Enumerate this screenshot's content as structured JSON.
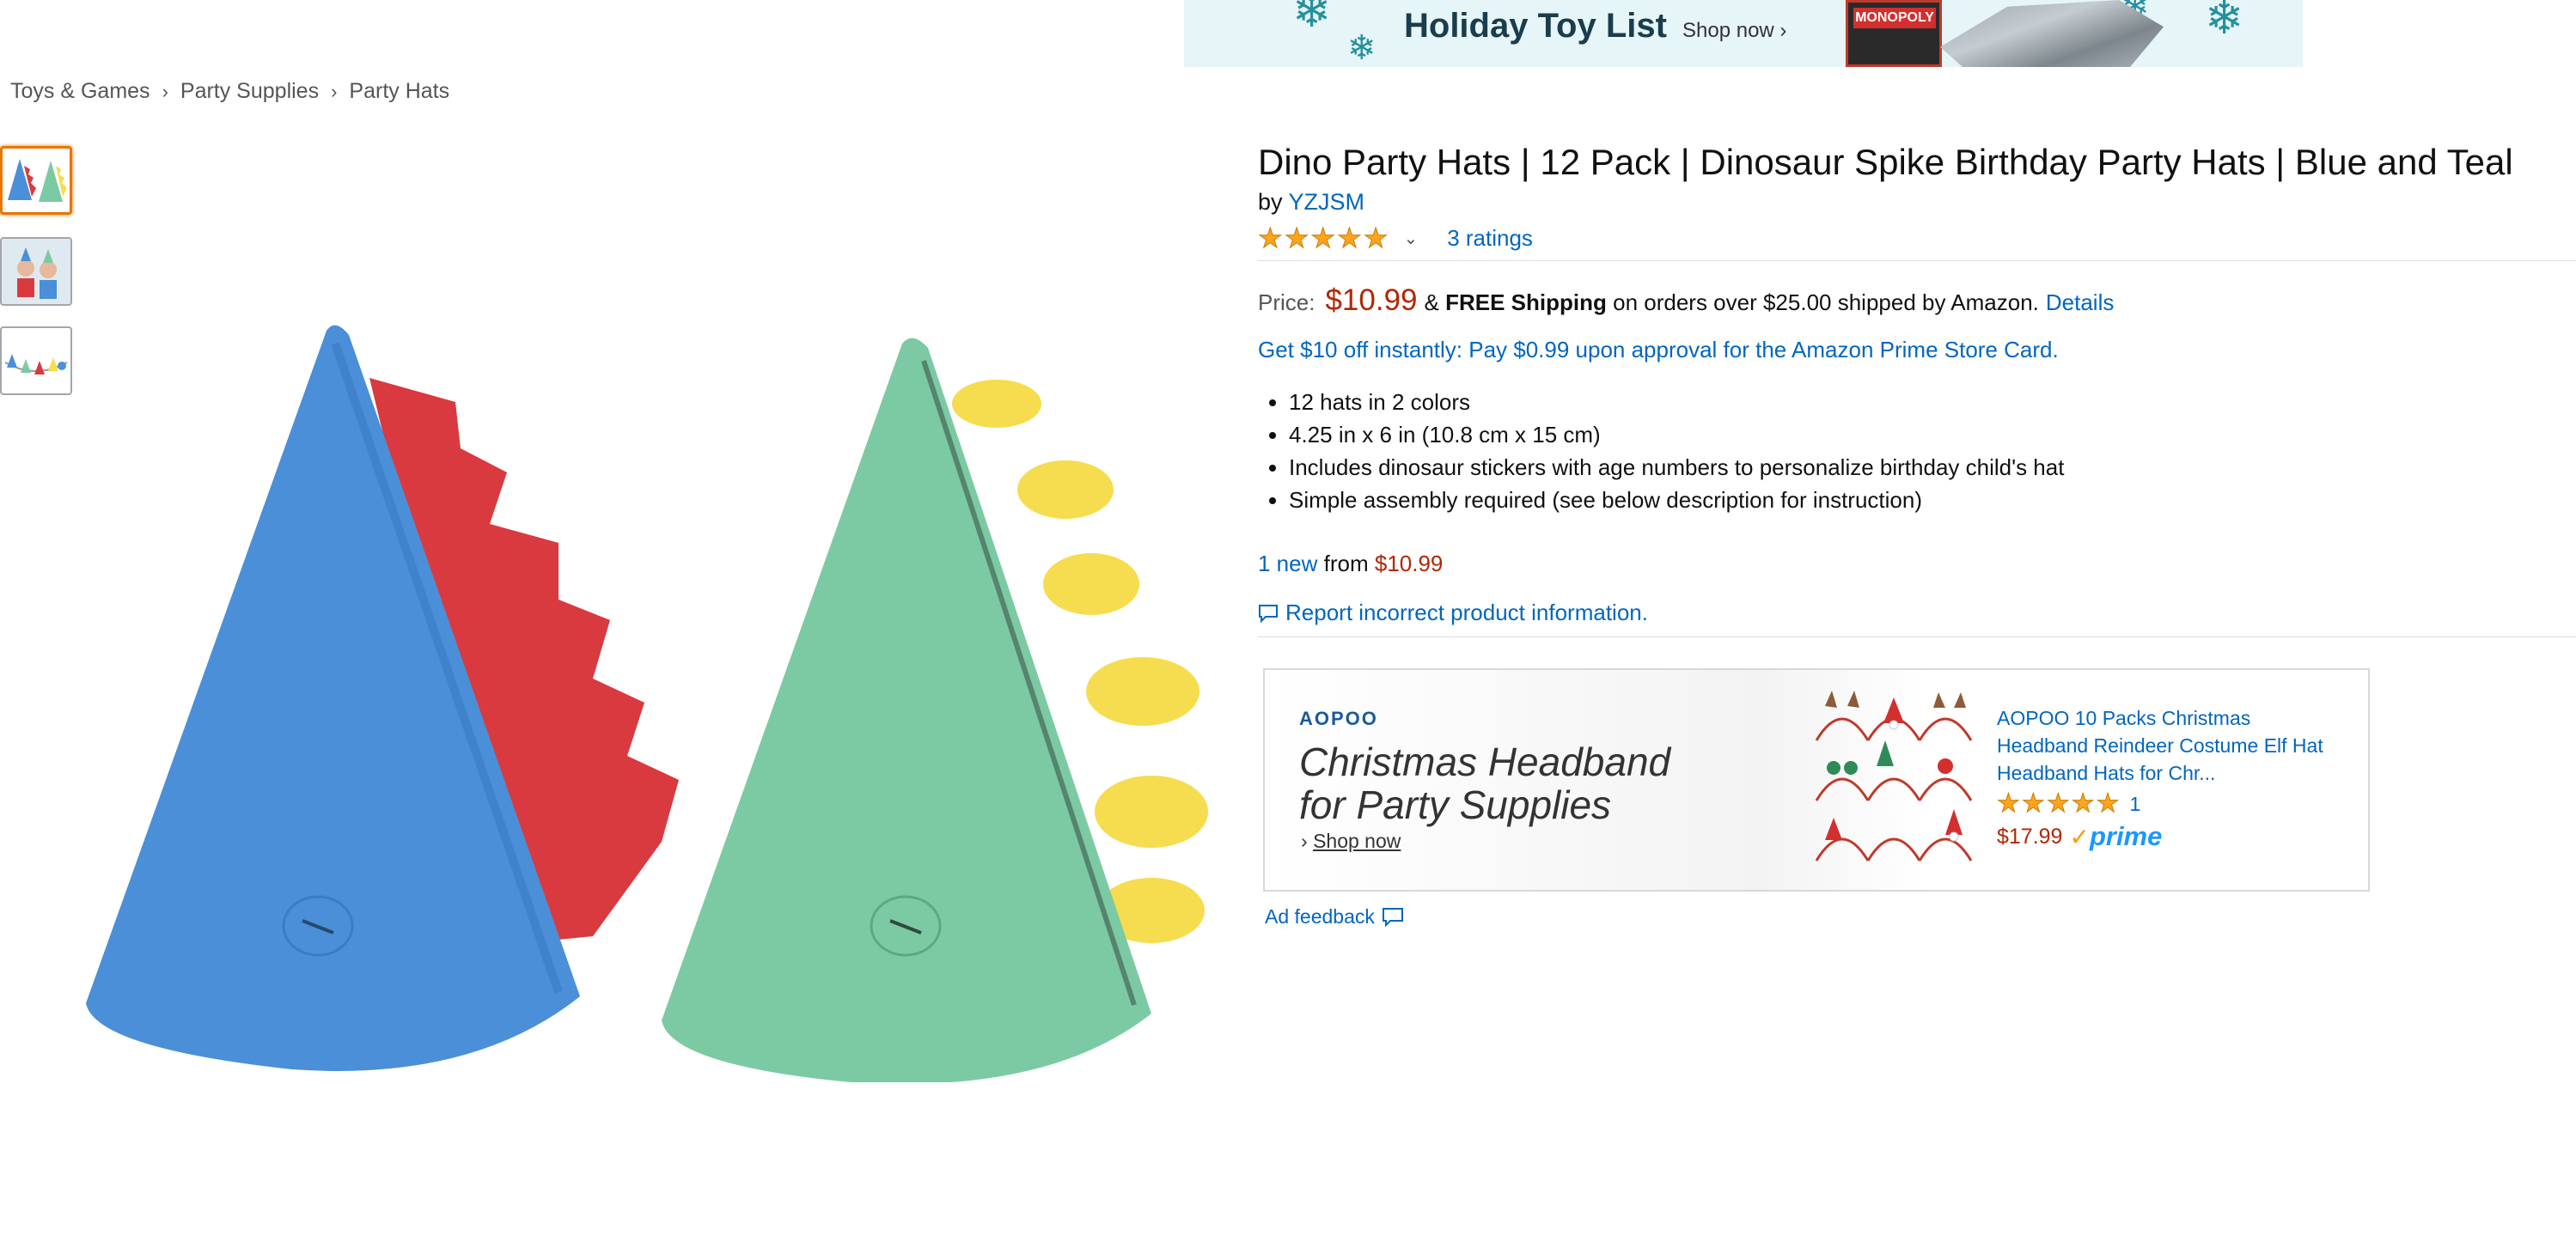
{
  "banner": {
    "title": "Holiday Toy List",
    "shop_label": "Shop now ›",
    "game_label": "MONOPOLY"
  },
  "breadcrumb": [
    "Toys & Games",
    "Party Supplies",
    "Party Hats"
  ],
  "breadcrumb_sep": "›",
  "product": {
    "title": "Dino Party Hats | 12 Pack | Dinosaur Spike Birthday Party Hats | Blue and Teal",
    "by_label": "by",
    "brand": "YZJSM",
    "rating": 5,
    "ratings_label": "3 ratings",
    "price_label": "Price:",
    "price": "$10.99",
    "shipping_amp": "&",
    "shipping_bold": "FREE Shipping",
    "shipping_rest": "on orders over $25.00 shipped by Amazon.",
    "details_label": "Details",
    "promo": "Get $10 off instantly: Pay $0.99 upon approval for the Amazon Prime Store Card.",
    "bullets": [
      "12 hats in 2 colors",
      "4.25 in x 6 in (10.8 cm x 15 cm)",
      "Includes dinosaur stickers with age numbers to personalize birthday child's hat",
      "Simple assembly required (see below description for instruction)"
    ],
    "offers_new": "1 new",
    "offers_from": "from",
    "offers_price": "$10.99",
    "report_label": "Report incorrect product information."
  },
  "ad": {
    "brand": "AOPOO",
    "headline": "Christmas Headband for Party Supplies",
    "shop_arrow": "›",
    "shop_label": "Shop now",
    "product_title": "AOPOO 10 Packs Christmas Headband Reindeer Costume Elf Hat Headband Hats for Chr...",
    "rating": 5,
    "rating_count": "1",
    "price": "$17.99",
    "prime_check": "✓",
    "prime_label": "prime",
    "feedback_label": "Ad feedback"
  },
  "colors": {
    "link": "#0066c0",
    "price": "#b12704",
    "star": "#ffa41c",
    "hat_blue": "#4a8fd8",
    "hat_teal": "#7ccaa3",
    "spikes_red": "#d93a3f",
    "spikes_yellow": "#f6dc4f"
  }
}
